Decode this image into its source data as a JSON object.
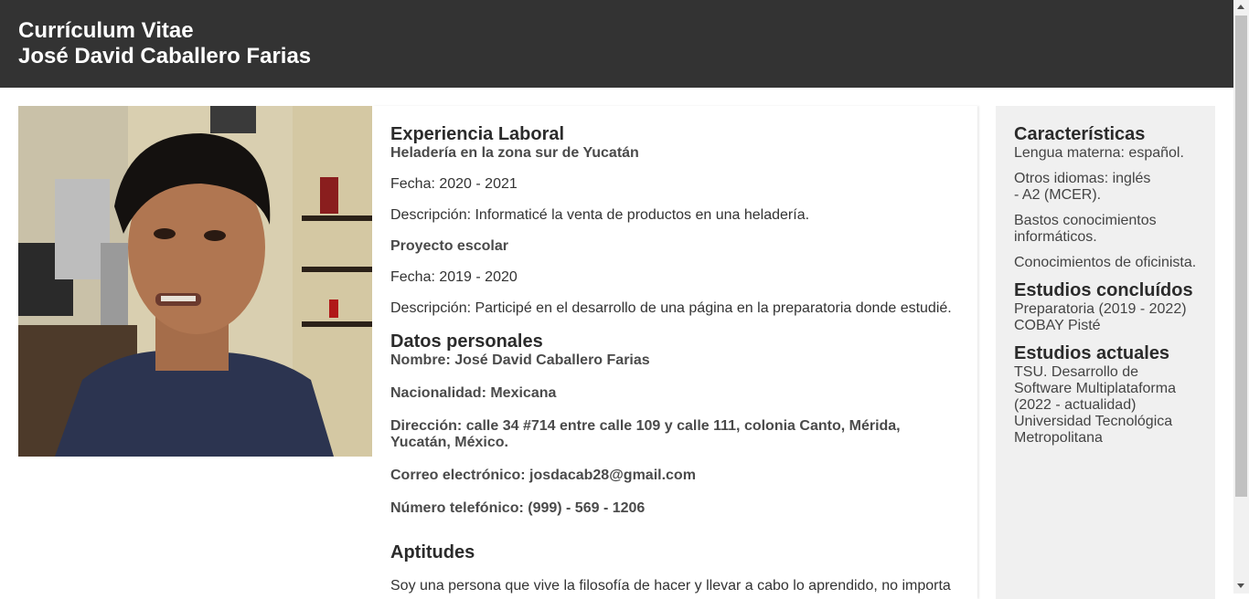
{
  "header": {
    "title": "Currículum Vitae",
    "name": "José David Caballero Farias"
  },
  "experience": {
    "heading": "Experiencia Laboral",
    "job1_title": "Heladería en la zona sur de Yucatán",
    "job1_date": "Fecha: 2020 - 2021",
    "job1_desc": "Descripción: Informaticé la venta de productos en una heladería.",
    "job2_title": "Proyecto escolar",
    "job2_date": "Fecha: 2019 - 2020",
    "job2_desc": "Descripción: Participé en el desarrollo de una página en la preparatoria donde estudié."
  },
  "personal": {
    "heading": "Datos personales",
    "name": "Nombre: José David Caballero Farias",
    "nationality": "Nacionalidad: Mexicana",
    "address_line1": "Dirección: calle 34 #714 entre calle 109 y calle 111, colonia Canto, Mérida,",
    "address_line2": "Yucatán, México.",
    "email": "Correo electrónico: josdacab28@gmail.com",
    "phone": "Número telefónico: (999) - 569 - 1206"
  },
  "skills": {
    "heading": "Aptitudes",
    "text": "Soy una persona que vive la filosofía de hacer y llevar a cabo lo aprendido, no importa"
  },
  "sidebar": {
    "characteristics_heading": "Características",
    "c1": "Lengua materna: español.",
    "c2_line1": "Otros idiomas: inglés",
    "c2_line2": "- A2 (MCER).",
    "c3_line1": "Bastos conocimientos",
    "c3_line2": "informáticos.",
    "c4": "Conocimientos de oficinista.",
    "completed_heading": "Estudios concluídos",
    "completed_line1": "Preparatoria (2019 - 2022)",
    "completed_line2": "COBAY Pisté",
    "current_heading": "Estudios actuales",
    "current_line1": "TSU. Desarrollo de",
    "current_line2": "Software Multiplataforma",
    "current_line3": "(2022 - actualidad)",
    "current_line4": "Universidad Tecnológica",
    "current_line5": "Metropolitana"
  }
}
